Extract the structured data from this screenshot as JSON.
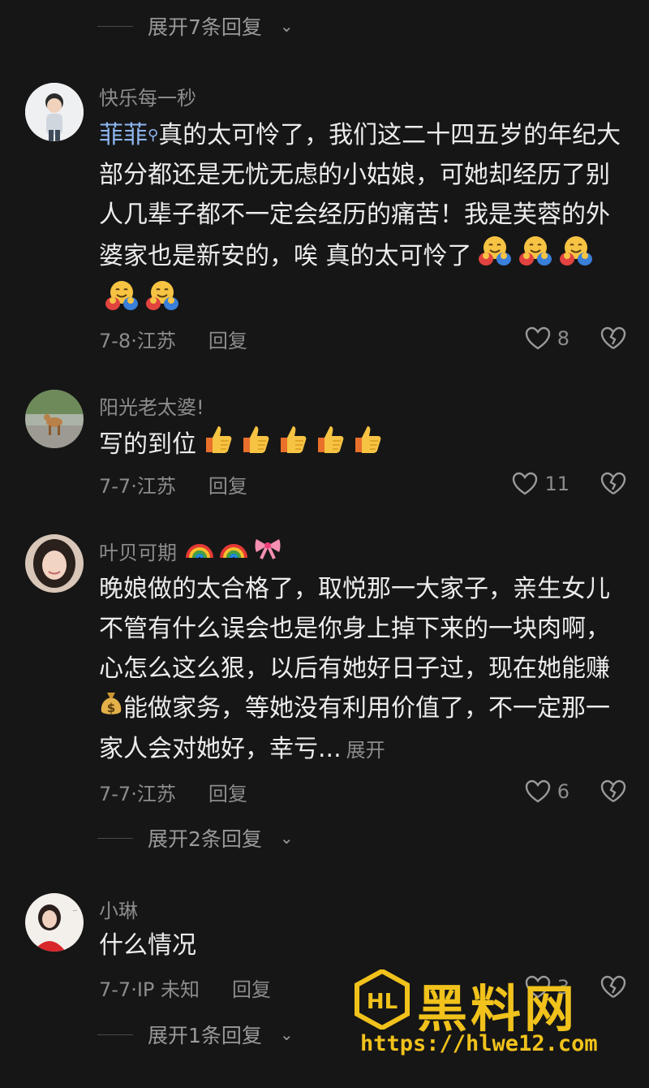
{
  "top_expand": {
    "label": "展开7条回复"
  },
  "comments": [
    {
      "username": "快乐每一秒",
      "mention": "菲菲",
      "text": "真的太可怜了，我们这二十四五岁的年纪大部分都还是无忧无虑的小姑娘，可她却经历了别人几辈子都不一定会经历的痛苦！我是芙蓉的外婆家也是新安的，唉 真的太可怜了",
      "emoji_name": "hugging-face-emoji",
      "emoji_count": 5,
      "date_location": "7-8·江苏",
      "reply_label": "回复",
      "likes": "8"
    },
    {
      "username": "阳光老太婆!",
      "text": "写的到位",
      "emoji_name": "thumbs-up-emoji",
      "emoji_count": 5,
      "date_location": "7-7·江苏",
      "reply_label": "回复",
      "likes": "11"
    },
    {
      "username": "叶贝可期",
      "username_emoji": [
        "rainbow-emoji",
        "rainbow-emoji",
        "ribbon-emoji"
      ],
      "text_part1": "晚娘做的太合格了，取悦那一大家子，亲生女儿不管有什么误会也是你身上掉下来的一块肉啊，心怎么这么狠，以后有她好日子过，现在她能赚",
      "text_part2": "能做家务，等她没有利用价值了，不一定那一家人会对她好，幸亏...",
      "inline_emoji": "money-bag-emoji",
      "more_label": "展开",
      "date_location": "7-7·江苏",
      "reply_label": "回复",
      "likes": "6",
      "expand_label": "展开2条回复"
    },
    {
      "username": "小琳",
      "text": "什么情况",
      "date_location": "7-7·IP 未知",
      "reply_label": "回复",
      "likes": "3",
      "expand_label": "展开1条回复"
    }
  ],
  "watermark": {
    "title": "黑料网",
    "url": "https://hlwe12.com"
  },
  "colors": {
    "background": "#161616",
    "mention": "#8fb6f0",
    "watermark": "#f1c21b"
  }
}
